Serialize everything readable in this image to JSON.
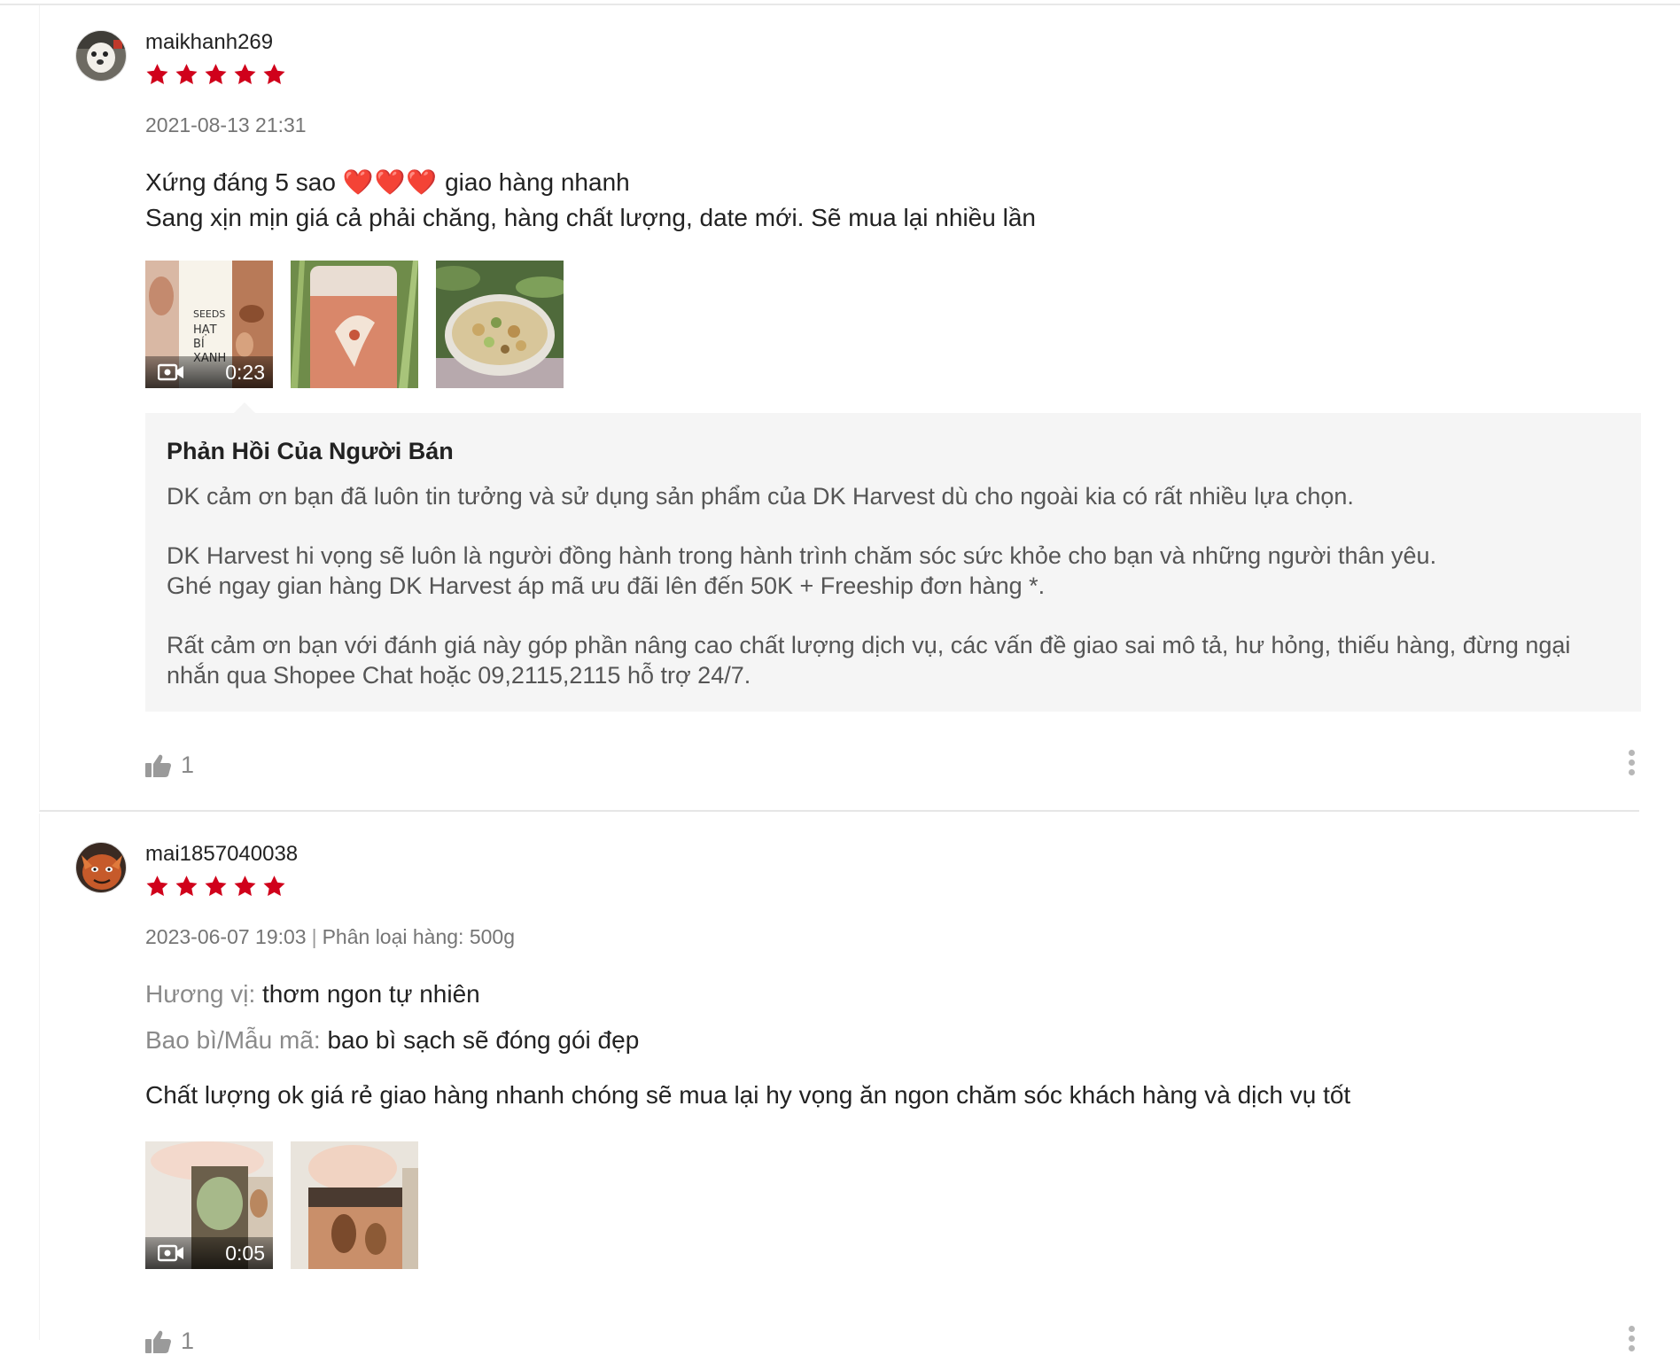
{
  "reviews": [
    {
      "username": "maikhanh269",
      "rating": 5,
      "date": "2021-08-13 21:31",
      "comment_line1_prefix": "Xứng đáng 5 sao",
      "comment_line1_hearts": "❤️❤️❤️",
      "comment_line1_suffix": "giao hàng nhanh",
      "comment_line2": "Sang xịn mịn giá cả phải chăng, hàng chất lượng, date mới. Sẽ mua lại nhiều lần",
      "media": [
        {
          "type": "video",
          "duration": "0:23",
          "text": [
            "SEEDS",
            "HẠT",
            "BÍ",
            "XANH"
          ]
        },
        {
          "type": "image"
        },
        {
          "type": "image"
        }
      ],
      "seller_reply": {
        "title": "Phản Hồi Của Người Bán",
        "p1": "DK cảm ơn bạn đã luôn tin tưởng và sử dụng sản phẩm của DK Harvest dù cho ngoài kia có rất nhiều lựa chọn.",
        "p2": "DK Harvest hi vọng sẽ luôn là người đồng hành trong hành trình chăm sóc sức khỏe cho bạn và những người thân yêu.",
        "p3": "Ghé ngay gian hàng DK Harvest áp mã ưu đãi lên đến 50K + Freeship đơn hàng *.",
        "p4": "Rất cảm ơn bạn với đánh giá này góp phần nâng cao chất lượng dịch vụ, các vấn đề giao sai mô tả, hư hỏng, thiếu hàng, đừng ngại nhắn qua Shopee Chat hoặc 09,2115,2115 hỗ trợ 24/7."
      },
      "likes": "1"
    },
    {
      "username": "mai1857040038",
      "rating": 5,
      "date": "2023-06-07 19:03",
      "separator": "|",
      "variation": "Phân loại hàng: 500g",
      "attributes": [
        {
          "key": "Hương vị:",
          "value": "thơm ngon tự nhiên"
        },
        {
          "key": "Bao bì/Mẫu mã:",
          "value": "bao bì sạch sẽ đóng gói đẹp"
        }
      ],
      "comment": "Chất lượng ok giá rẻ giao hàng nhanh chóng sẽ mua lại hy vọng ăn ngon chăm sóc khách hàng và dịch vụ tốt",
      "media": [
        {
          "type": "video",
          "duration": "0:05"
        },
        {
          "type": "image"
        }
      ],
      "likes": "1"
    }
  ],
  "colors": {
    "star": "#d0011b",
    "reply_bg": "#f5f5f5",
    "muted": "#757575"
  }
}
